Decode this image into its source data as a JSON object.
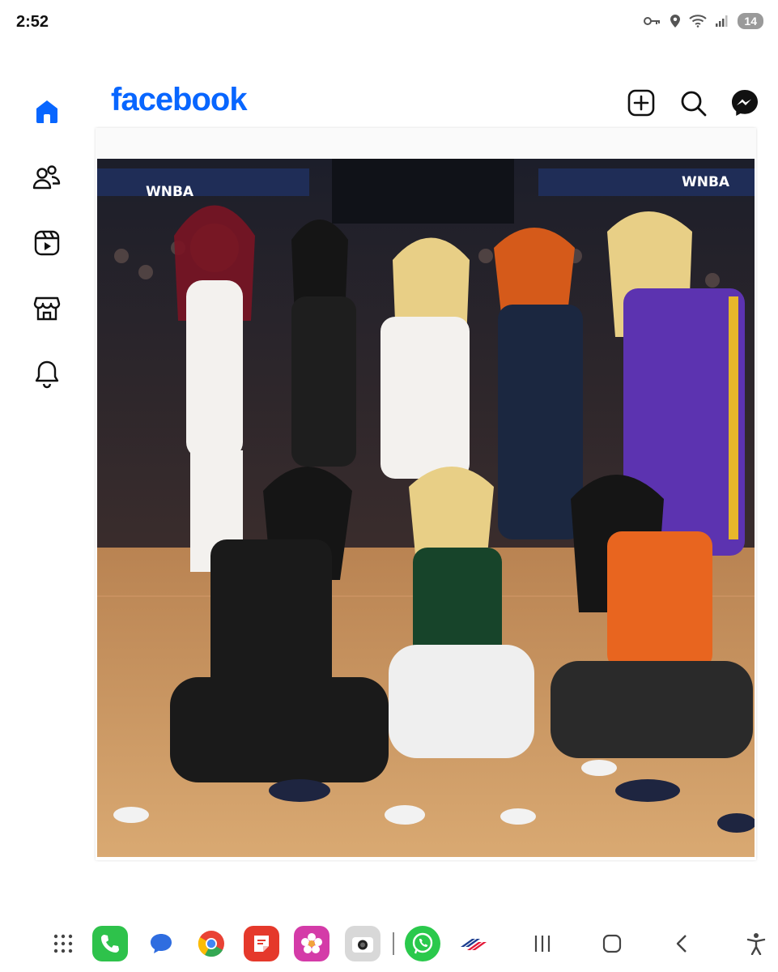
{
  "status_bar": {
    "time": "2:52",
    "battery": "14",
    "icons": [
      "key-icon",
      "location-icon",
      "wifi-icon",
      "signal-icon"
    ]
  },
  "app": {
    "name": "facebook",
    "brand_color": "#0866ff"
  },
  "nav_rail": {
    "items": [
      {
        "name": "home",
        "icon": "home-icon",
        "active": true
      },
      {
        "name": "friends",
        "icon": "friends-icon",
        "active": false
      },
      {
        "name": "video",
        "icon": "video-icon",
        "active": false
      },
      {
        "name": "marketplace",
        "icon": "marketplace-icon",
        "active": false
      },
      {
        "name": "notifications",
        "icon": "bell-icon",
        "active": false
      }
    ]
  },
  "header_actions": [
    "create-icon",
    "search-icon",
    "messenger-icon"
  ],
  "post": {
    "image_signage": [
      "WNBA",
      "WNBA"
    ]
  },
  "taskbar": {
    "apps": [
      "app-drawer-icon",
      "phone-icon",
      "messages-icon",
      "chrome-icon",
      "notes-icon",
      "gallery-icon",
      "camera-icon",
      "whatsapp-icon",
      "bank-icon"
    ],
    "system": [
      "recents-icon",
      "home-button-icon",
      "back-icon",
      "accessibility-icon"
    ]
  }
}
